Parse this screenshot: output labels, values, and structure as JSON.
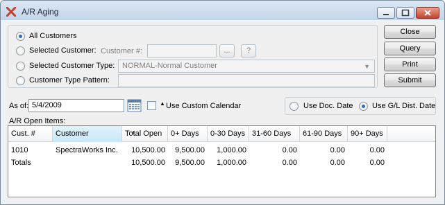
{
  "window": {
    "title": "A/R Aging",
    "accent_color": "#c4422b"
  },
  "selection": {
    "all_customers": "All Customers",
    "selected_customer": "Selected Customer:",
    "customer_number_label": "Customer #:",
    "customer_number_value": "",
    "ellipsis": "...",
    "help": "?",
    "selected_customer_type": "Selected Customer Type:",
    "customer_type_value": "NORMAL-Normal Customer",
    "customer_type_pattern": "Customer Type Pattern:",
    "pattern_value": "",
    "selected_option": "All Customers"
  },
  "actions": {
    "close": "Close",
    "query": "Query",
    "print": "Print",
    "submit": "Submit"
  },
  "as_of": {
    "label": "As of:",
    "value": "5/4/2009",
    "use_custom_calendar": "Use Custom Calendar",
    "custom_calendar_checked": false
  },
  "distribution": {
    "use_doc_date": "Use Doc. Date",
    "use_gl_dist_date": "Use G/L Dist. Date",
    "selected": "Use G/L Dist. Date"
  },
  "open_items": {
    "label": "A/R Open Items:",
    "columns": [
      "Cust. #",
      "Customer",
      "Total Open",
      "0+ Days",
      "0-30 Days",
      "31-60 Days",
      "61-90 Days",
      "90+ Days"
    ],
    "sorted_column": "Customer",
    "rows": [
      [
        "1010",
        "SpectraWorks Inc.",
        "10,500.00",
        "9,500.00",
        "1,000.00",
        "0.00",
        "0.00",
        "0.00"
      ],
      [
        "Totals",
        "",
        "10,500.00",
        "9,500.00",
        "1,000.00",
        "0.00",
        "0.00",
        "0.00"
      ]
    ]
  }
}
